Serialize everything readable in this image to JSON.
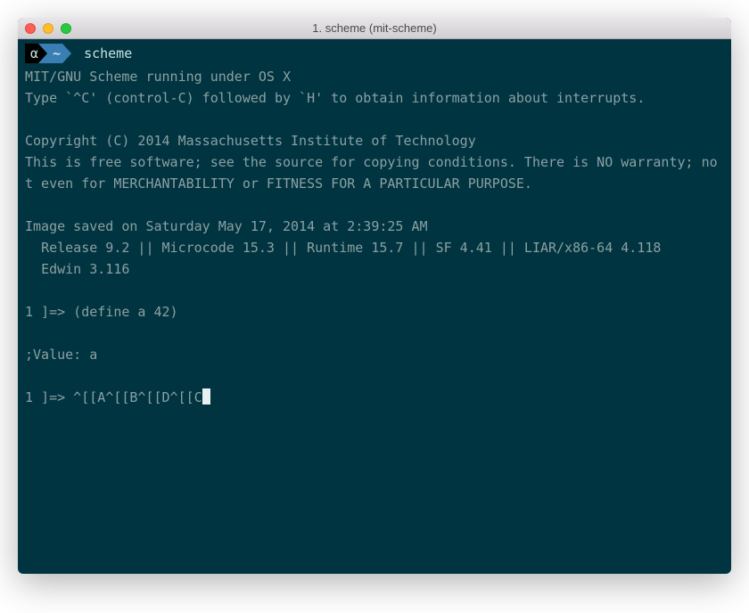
{
  "window": {
    "title": "1. scheme (mit-scheme)"
  },
  "prompt": {
    "alpha": "α",
    "tilde": "~",
    "command": "scheme"
  },
  "lines": {
    "l1": "MIT/GNU Scheme running under OS X",
    "l2": "Type `^C' (control-C) followed by `H' to obtain information about interrupts.",
    "l3": "Copyright (C) 2014 Massachusetts Institute of Technology",
    "l4": "This is free software; see the source for copying conditions. There is NO warranty; not even for MERCHANTABILITY or FITNESS FOR A PARTICULAR PURPOSE.",
    "l5": "Image saved on Saturday May 17, 2014 at 2:39:25 AM",
    "l6": "  Release 9.2 || Microcode 15.3 || Runtime 15.7 || SF 4.41 || LIAR/x86-64 4.118",
    "l7": "  Edwin 3.116",
    "l8": "1 ]=> (define a 42)",
    "l9": ";Value: a",
    "l10": "1 ]=> ^[[A^[[B^[[D^[[C"
  }
}
